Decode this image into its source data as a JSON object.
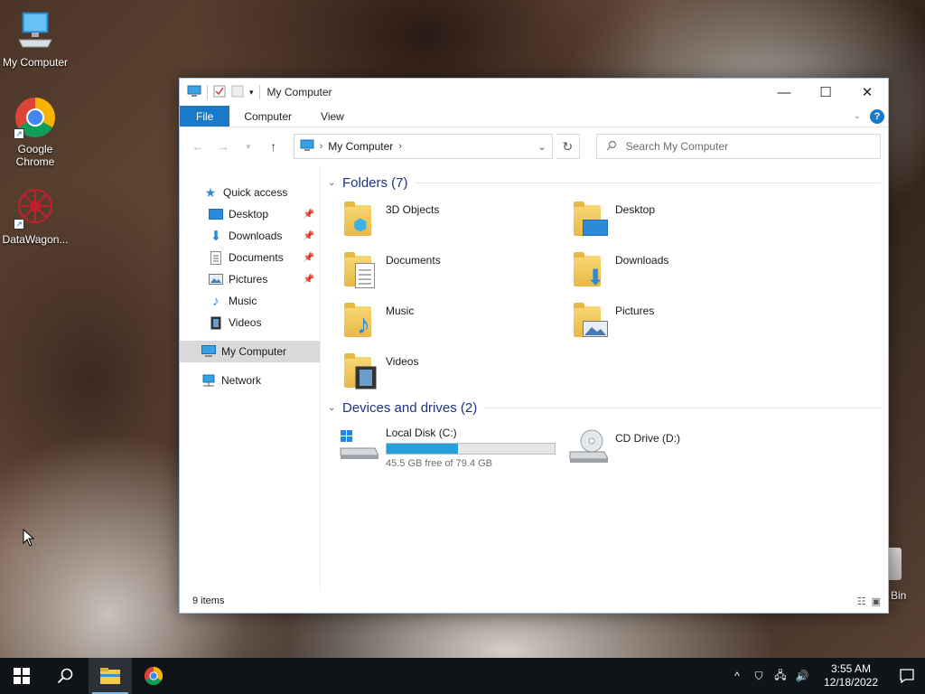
{
  "desktop": {
    "icons": [
      {
        "label": "My Computer"
      },
      {
        "label": "Google Chrome"
      },
      {
        "label": "DataWagon..."
      }
    ],
    "recycle_bin_partial": "Bin"
  },
  "window": {
    "title": "My Computer",
    "ribbon": {
      "tabs": [
        "File",
        "Computer",
        "View"
      ]
    },
    "address": {
      "crumb": "My Computer"
    },
    "search": {
      "placeholder": "Search My Computer"
    },
    "nav": {
      "quick_access": "Quick access",
      "pinned": [
        "Desktop",
        "Downloads",
        "Documents",
        "Pictures"
      ],
      "unpinned": [
        "Music",
        "Videos"
      ],
      "my_computer": "My Computer",
      "network": "Network"
    },
    "groups": {
      "folders_title": "Folders (7)",
      "folders": [
        "3D Objects",
        "Desktop",
        "Documents",
        "Downloads",
        "Music",
        "Pictures",
        "Videos"
      ],
      "drives_title": "Devices and drives (2)",
      "drives": [
        {
          "name": "Local Disk (C:)",
          "free_text": "45.5 GB free of 79.4 GB",
          "used_fraction": 0.427
        },
        {
          "name": "CD Drive (D:)"
        }
      ]
    },
    "status": {
      "items": "9 items"
    }
  },
  "taskbar": {
    "time": "3:55 AM",
    "date": "12/18/2022"
  },
  "colors": {
    "accent": "#1979ca",
    "drive_bar": "#26a0da",
    "group_header": "#1e3287"
  }
}
